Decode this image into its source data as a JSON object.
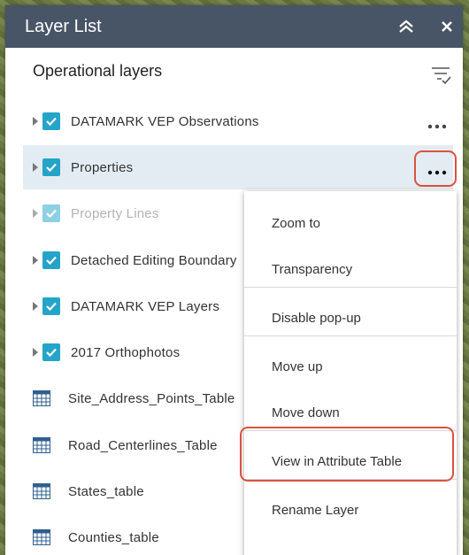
{
  "panel": {
    "title": "Layer List",
    "section_header": "Operational layers"
  },
  "layers": [
    {
      "label": "DATAMARK VEP Observations",
      "checked": true
    },
    {
      "label": "Properties",
      "checked": true,
      "selected": true
    },
    {
      "label": "Property Lines",
      "checked": true,
      "dimmed": true
    },
    {
      "label": "Detached Editing Boundary",
      "checked": true
    },
    {
      "label": "DATAMARK VEP Layers",
      "checked": true
    },
    {
      "label": "2017 Orthophotos",
      "checked": true
    }
  ],
  "tables": [
    {
      "label": "Site_Address_Points_Table"
    },
    {
      "label": "Road_Centerlines_Table"
    },
    {
      "label": "States_table"
    },
    {
      "label": "Counties_table"
    }
  ],
  "context_menu": {
    "items": [
      {
        "label": "Zoom to"
      },
      {
        "label": "Transparency"
      },
      {
        "label": "Disable pop-up"
      },
      {
        "label": "Move up"
      },
      {
        "label": "Move down"
      },
      {
        "label": "View in Attribute Table",
        "highlighted": true
      },
      {
        "label": "Rename Layer"
      }
    ]
  },
  "colors": {
    "titlebar": "#485566",
    "checkbox": "#24a4c8",
    "highlight": "#d9533f",
    "selected_row": "#e4ecf3"
  },
  "icons": [
    "collapse-icon",
    "close-icon",
    "sort-icon",
    "expander-icon",
    "check-icon",
    "table-icon",
    "more-icon"
  ]
}
